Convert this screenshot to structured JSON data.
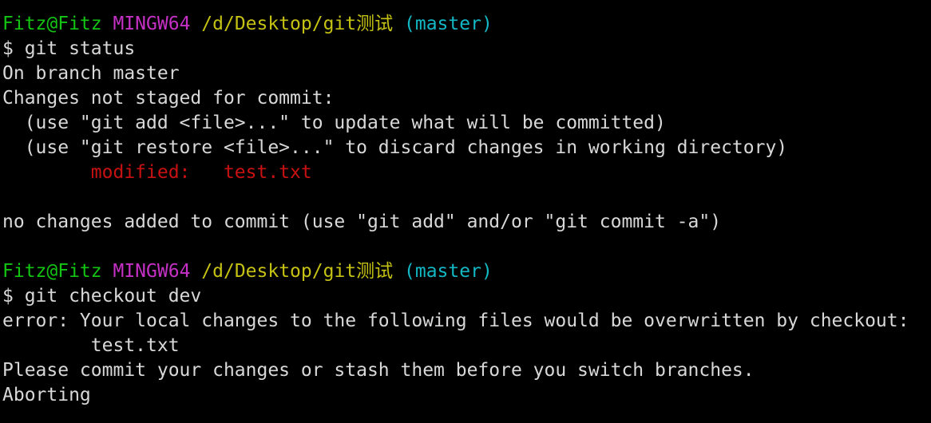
{
  "colors": {
    "background": "#000000",
    "text": "#d8d8d8",
    "user_host": "#13c413",
    "msystem": "#c530c5",
    "path": "#c5c213",
    "branch": "#13b8c5",
    "modified": "#c81111"
  },
  "prompt": {
    "user_host": "Fitz@Fitz",
    "msystem": "MINGW64",
    "path": "/d/Desktop/git测试",
    "branch": "(master)"
  },
  "session1": {
    "command": "$ git status",
    "on_branch": "On branch master",
    "changes_header": "Changes not staged for commit:",
    "hint_add": "  (use \"git add <file>...\" to update what will be committed)",
    "hint_restore": "  (use \"git restore <file>...\" to discard changes in working directory)",
    "modified_indent": "        ",
    "modified_label": "modified:   ",
    "modified_file": "test.txt",
    "no_changes": "no changes added to commit (use \"git add\" and/or \"git commit -a\")"
  },
  "session2": {
    "command": "$ git checkout dev",
    "error": "error: Your local changes to the following files would be overwritten by checkout:",
    "file": "        test.txt",
    "please_commit": "Please commit your changes or stash them before you switch branches.",
    "aborting": "Aborting"
  }
}
